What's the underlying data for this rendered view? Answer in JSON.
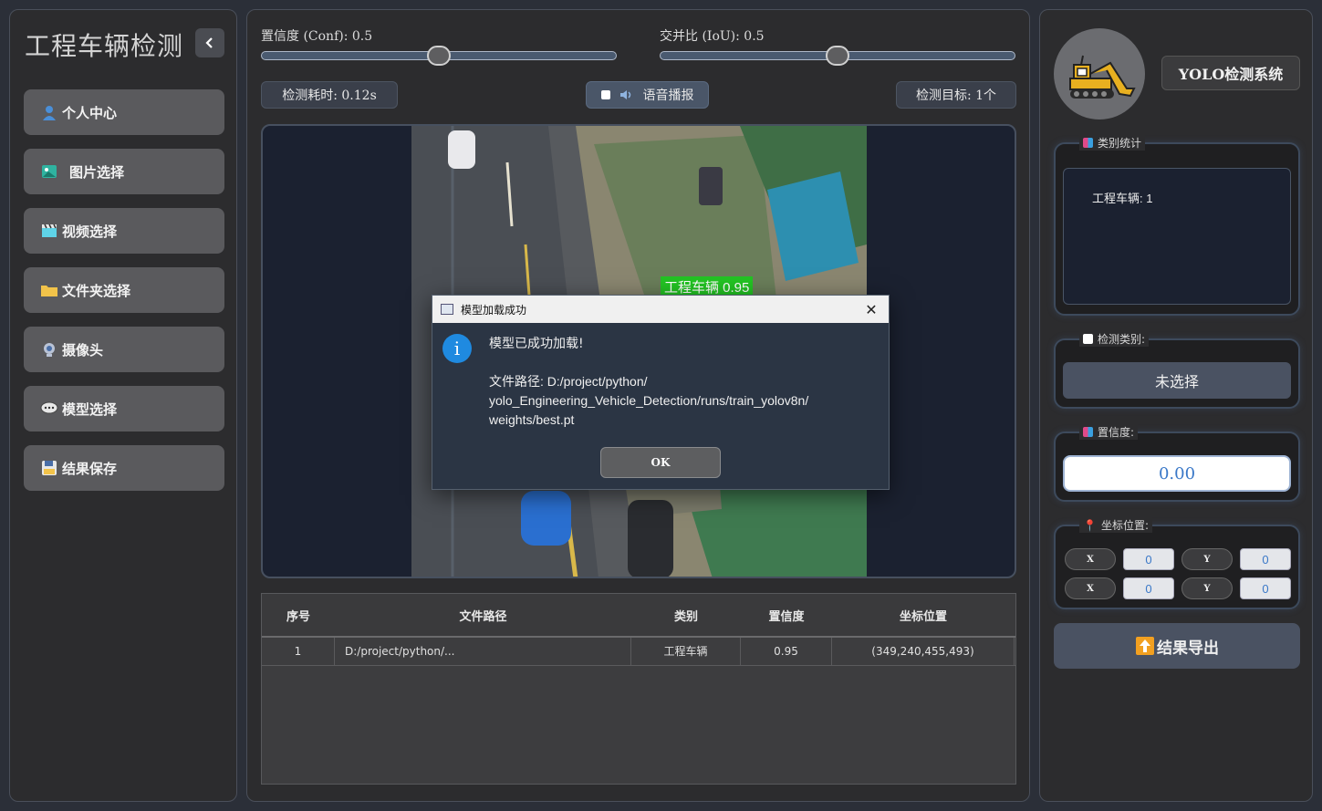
{
  "sidebar": {
    "title": "工程车辆检测",
    "items": [
      {
        "label": "个人中心",
        "icon": "user-icon"
      },
      {
        "label": "图片选择",
        "icon": "image-icon"
      },
      {
        "label": "视频选择",
        "icon": "clapperboard-icon"
      },
      {
        "label": "文件夹选择",
        "icon": "folder-icon"
      },
      {
        "label": "摄像头",
        "icon": "webcam-icon"
      },
      {
        "label": "模型选择",
        "icon": "chat-bubble-icon"
      },
      {
        "label": "结果保存",
        "icon": "floppy-icon"
      }
    ]
  },
  "controls": {
    "conf_label": "置信度 (Conf): 0.5",
    "conf_value": 0.5,
    "iou_label": "交并比 (IoU): 0.5",
    "iou_value": 0.5,
    "time_label": "检测耗时: 0.12s",
    "voice_label": "语音播报",
    "target_label": "检测目标: 1个"
  },
  "viewer": {
    "detection_label": "工程车辆 0.95"
  },
  "table": {
    "headers": [
      "序号",
      "文件路径",
      "类别",
      "置信度",
      "坐标位置"
    ],
    "rows": [
      {
        "index": "1",
        "path": "D:/project/python/...",
        "class": "工程车辆",
        "conf": "0.95",
        "coords": "(349,240,455,493)"
      }
    ]
  },
  "dialog": {
    "title": "模型加载成功",
    "message": "模型已成功加载!",
    "path_text": "文件路径: D:/project/python/ yolo_Engineering_Vehicle_Detection/runs/train_yolov8n/ weights/best.pt",
    "ok_label": "OK"
  },
  "right": {
    "system_title": "YOLO检测系统",
    "stats_label": "类别统计",
    "stats_text": "工程车辆: 1",
    "class_label": "检测类别:",
    "class_value": "未选择",
    "conf_label": "置信度:",
    "conf_value": "0.00",
    "coord_label": "坐标位置:",
    "coords": {
      "x1_label": "X",
      "x1": "0",
      "y1_label": "Y",
      "y1": "0",
      "x2_label": "X",
      "x2": "0",
      "y2_label": "Y",
      "y2": "0"
    },
    "export_label": "结果导出"
  }
}
